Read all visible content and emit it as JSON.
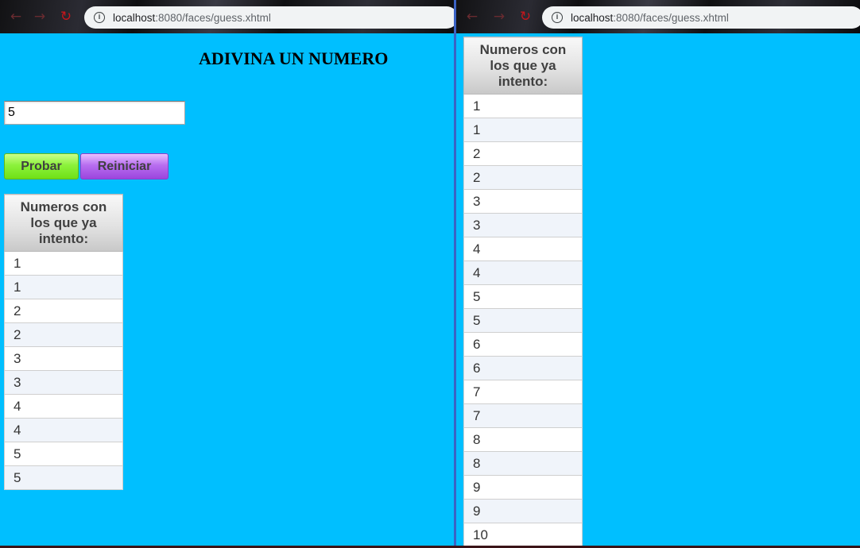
{
  "browser": {
    "url_host": "localhost",
    "url_path": ":8080/faces/guess.xhtml",
    "info_icon_glyph": "i",
    "back_icon": "arrow-left",
    "forward_icon": "arrow-right",
    "reload_icon": "reload",
    "icon_color": "#c4161c"
  },
  "page": {
    "title": "ADIVINA UN NUMERO",
    "background_color": "#00bfff",
    "guess_input_value": "5",
    "probar_label": "Probar",
    "reiniciar_label": "Reiniciar",
    "probar_color": "#8cf23c",
    "reiniciar_color": "#b86ef0"
  },
  "table": {
    "header": "Numeros con los que ya intento:"
  },
  "left_rows": [
    "1",
    "1",
    "2",
    "2",
    "3",
    "3",
    "4",
    "4",
    "5",
    "5"
  ],
  "right_rows": [
    "1",
    "1",
    "2",
    "2",
    "3",
    "3",
    "4",
    "4",
    "5",
    "5",
    "6",
    "6",
    "7",
    "7",
    "8",
    "8",
    "9",
    "9",
    "10"
  ]
}
